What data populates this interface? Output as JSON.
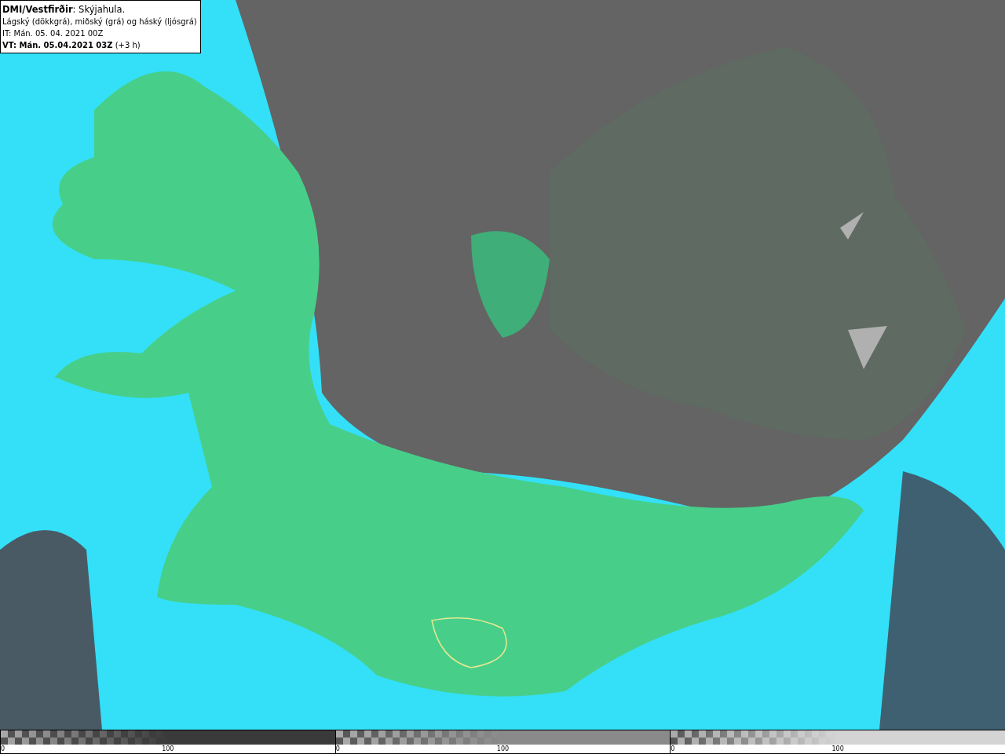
{
  "legend": {
    "lines": [
      "**DMI/Vestfirðir**: Skýjahula.",
      "Lágský (dökkgrá), miðský (grá) og háský (ljósgrá)",
      "IT: Mán. 05. 04. 2021 00Z",
      "**VT: Mán. 05.04.2021 03Z** (+3 h)"
    ]
  },
  "colorbars": [
    {
      "color": "#3a3a3a",
      "labels": [
        "0",
        "100"
      ]
    },
    {
      "color": "#8a8a8a",
      "labels": [
        "0",
        "100"
      ]
    },
    {
      "color": "#d4d4d4",
      "labels": [
        "0",
        "100"
      ]
    }
  ]
}
